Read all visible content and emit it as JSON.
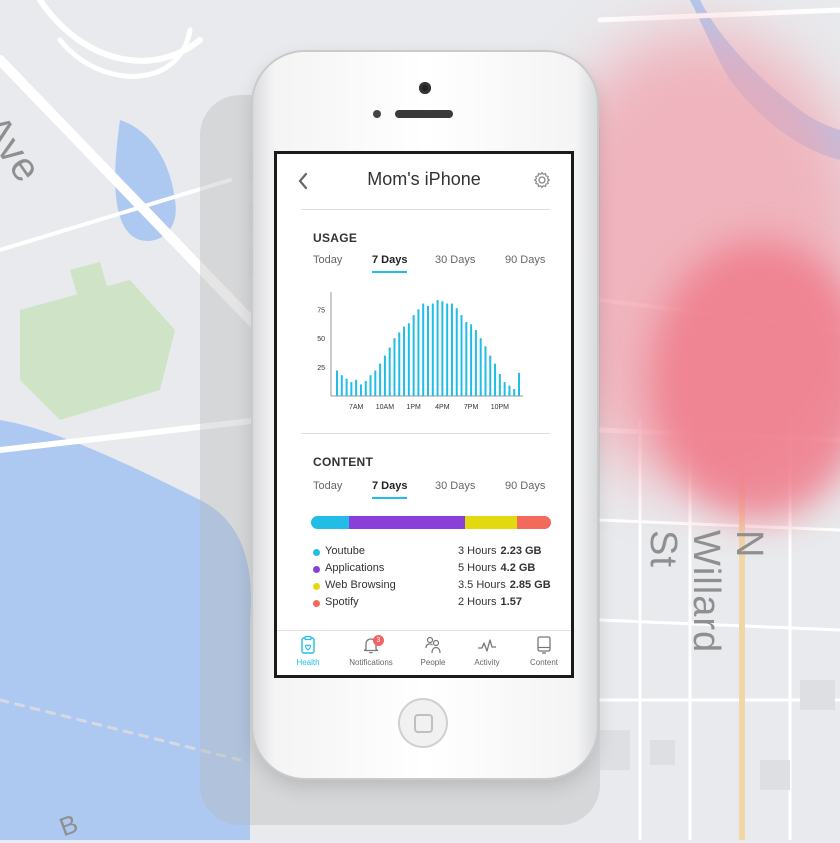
{
  "map": {
    "street_labels": [
      "h Ave",
      "N Willard St",
      "B"
    ]
  },
  "screen": {
    "title": "Mom's iPhone",
    "back_icon": "chevron-left-icon",
    "settings_icon": "gear-icon"
  },
  "usage": {
    "section_title": "USAGE",
    "tabs": [
      {
        "label": "Today",
        "active": false
      },
      {
        "label": "7 Days",
        "active": true
      },
      {
        "label": "30 Days",
        "active": false
      },
      {
        "label": "90 Days",
        "active": false
      }
    ]
  },
  "chart_data": {
    "type": "bar",
    "title": "",
    "xlabel": "",
    "ylabel": "",
    "ylim": [
      0,
      90
    ],
    "yticks": [
      25,
      50,
      75
    ],
    "xtick_labels": [
      "7AM",
      "10AM",
      "1PM",
      "4PM",
      "7PM",
      "10PM"
    ],
    "color": "#21bde6",
    "values": [
      22,
      18,
      15,
      12,
      14,
      10,
      13,
      18,
      22,
      28,
      35,
      42,
      50,
      55,
      60,
      63,
      70,
      75,
      80,
      78,
      80,
      83,
      82,
      80,
      80,
      76,
      70,
      64,
      62,
      57,
      50,
      43,
      35,
      28,
      19,
      12,
      9,
      6,
      20
    ]
  },
  "content": {
    "section_title": "CONTENT",
    "tabs": [
      {
        "label": "Today",
        "active": false
      },
      {
        "label": "7 Days",
        "active": true
      },
      {
        "label": "30 Days",
        "active": false
      },
      {
        "label": "90 Days",
        "active": false
      }
    ],
    "items": [
      {
        "name": "Youtube",
        "hours": "3 Hours",
        "data": "2.23 GB",
        "color": "#21bde6",
        "share": 0.16
      },
      {
        "name": "Applications",
        "hours": "5 Hours",
        "data": "4.2 GB",
        "color": "#8b3fd9",
        "share": 0.48
      },
      {
        "name": "Web Browsing",
        "hours": "3.5 Hours",
        "data": "2.85 GB",
        "color": "#e3d910",
        "share": 0.22
      },
      {
        "name": "Spotify",
        "hours": "2 Hours",
        "data": "1.57",
        "color": "#f26a5c",
        "share": 0.14
      }
    ]
  },
  "tabbar": {
    "items": [
      {
        "label": "Health",
        "icon": "health-clipboard-icon",
        "active": true
      },
      {
        "label": "Notifications",
        "icon": "bell-icon",
        "active": false,
        "badge": "3"
      },
      {
        "label": "People",
        "icon": "people-icon",
        "active": false
      },
      {
        "label": "Activity",
        "icon": "activity-pulse-icon",
        "active": false
      },
      {
        "label": "Content",
        "icon": "device-content-icon",
        "active": false
      }
    ]
  },
  "colors": {
    "accent": "#21bde6",
    "heatmap": "#f06a7a",
    "water": "#aec9f1",
    "park": "#cfe3c6"
  }
}
